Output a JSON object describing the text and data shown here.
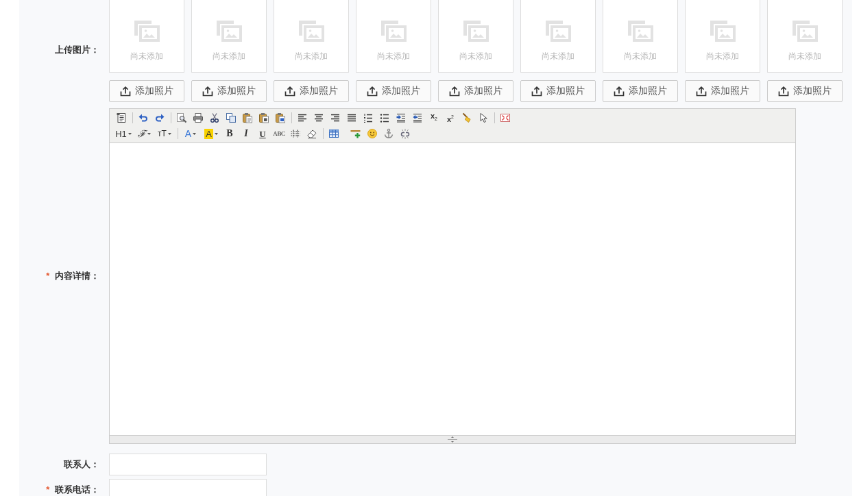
{
  "upload": {
    "label": "上传图片：",
    "slots": [
      {
        "caption": "尚未添加",
        "button": "添加照片"
      },
      {
        "caption": "尚未添加",
        "button": "添加照片"
      },
      {
        "caption": "尚未添加",
        "button": "添加照片"
      },
      {
        "caption": "尚未添加",
        "button": "添加照片"
      },
      {
        "caption": "尚未添加",
        "button": "添加照片"
      },
      {
        "caption": "尚未添加",
        "button": "添加照片"
      },
      {
        "caption": "尚未添加",
        "button": "添加照片"
      },
      {
        "caption": "尚未添加",
        "button": "添加照片"
      },
      {
        "caption": "尚未添加",
        "button": "添加照片"
      }
    ]
  },
  "editor": {
    "required_mark": "*",
    "label": "内容详情：",
    "toolbar": {
      "script_buttons": [
        {
          "kind": "subscript",
          "text": "x$_{2}$",
          "dropdown": false
        },
        {
          "kind": "superscript",
          "text": "x$^{2}$",
          "dropdown": false
        }
      ],
      "heading_buttons": [
        {
          "kind": "heading",
          "text": "H1",
          "dropdown": true
        },
        {
          "kind": "font-family",
          "text": "ℱ",
          "dropdown": true
        },
        {
          "kind": "font-size",
          "text": "ᴛT",
          "dropdown": true
        }
      ],
      "format_buttons": [
        {
          "kind": "font-color",
          "text": "A",
          "dropdown": true
        },
        {
          "kind": "highlight",
          "text": "A",
          "dropdown": true
        },
        {
          "kind": "bold",
          "text": "B",
          "dropdown": false
        },
        {
          "kind": "italic",
          "text": "I",
          "dropdown": false
        },
        {
          "kind": "underline",
          "text": "U",
          "dropdown": false
        },
        {
          "kind": "strikethrough",
          "text": "ABC",
          "dropdown": false
        }
      ]
    }
  },
  "fields": [
    {
      "label": "联系人："
    },
    {
      "required_mark": "*",
      "label": "联系电话："
    }
  ]
}
